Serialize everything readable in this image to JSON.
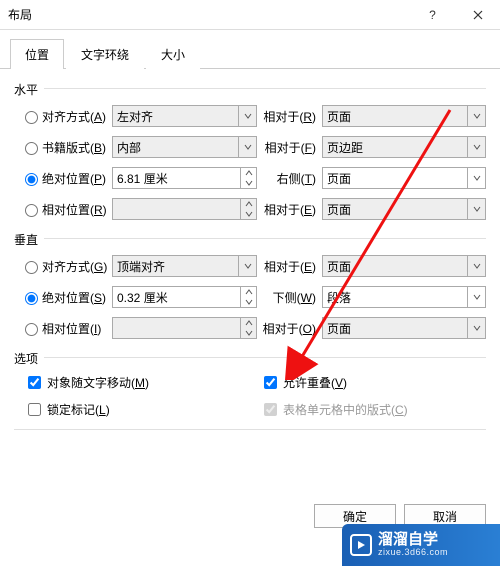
{
  "window": {
    "title": "布局",
    "help": "?",
    "close": "×"
  },
  "tabs": {
    "position": "位置",
    "wrapping": "文字环绕",
    "size": "大小"
  },
  "groups": {
    "horizontal": "水平",
    "vertical": "垂直",
    "options": "选项"
  },
  "horizontal": {
    "align": {
      "label_pre": "对齐方式(",
      "key": "A",
      "label_post": ")",
      "value": "左对齐",
      "rel_label_pre": "相对于(",
      "rel_key": "R",
      "rel_label_post": ")",
      "rel_value": "页面"
    },
    "book": {
      "label_pre": "书籍版式(",
      "key": "B",
      "label_post": ")",
      "value": "内部",
      "rel_label_pre": "相对于(",
      "rel_key": "F",
      "rel_label_post": ")",
      "rel_value": "页边距"
    },
    "abs": {
      "label_pre": "绝对位置(",
      "key": "P",
      "label_post": ")",
      "value": "6.81 厘米",
      "rel_label_pre": "右侧(",
      "rel_key": "T",
      "rel_label_post": ")",
      "rel_value": "页面"
    },
    "rel": {
      "label_pre": "相对位置(",
      "key": "R",
      "label_post": ")",
      "value": "",
      "rel_label_pre": "相对于(",
      "rel_key": "E",
      "rel_label_post": ")",
      "rel_value": "页面"
    }
  },
  "vertical": {
    "align": {
      "label_pre": "对齐方式(",
      "key": "G",
      "label_post": ")",
      "value": "顶端对齐",
      "rel_label_pre": "相对于(",
      "rel_key": "E",
      "rel_label_post": ")",
      "rel_value": "页面"
    },
    "abs": {
      "label_pre": "绝对位置(",
      "key": "S",
      "label_post": ")",
      "value": "0.32 厘米",
      "rel_label_pre": "下侧(",
      "rel_key": "W",
      "rel_label_post": ")",
      "rel_value": "段落"
    },
    "rel": {
      "label_pre": "相对位置(",
      "key": "I",
      "label_post": ")",
      "value": "",
      "rel_label_pre": "相对于(",
      "rel_key": "O",
      "rel_label_post": ")",
      "rel_value": "页面"
    }
  },
  "options": {
    "move": {
      "label_pre": "对象随文字移动(",
      "key": "M",
      "label_post": ")"
    },
    "lock": {
      "label_pre": "锁定标记(",
      "key": "L",
      "label_post": ")"
    },
    "overlap": {
      "label_pre": "允许重叠(",
      "key": "V",
      "label_post": ")"
    },
    "table": {
      "label_pre": "表格单元格中的版式(",
      "key": "C",
      "label_post": ")"
    }
  },
  "buttons": {
    "ok": "确定",
    "cancel": "取消"
  },
  "watermark": {
    "brand": "溜溜自学",
    "url": "zixue.3d66.com"
  }
}
